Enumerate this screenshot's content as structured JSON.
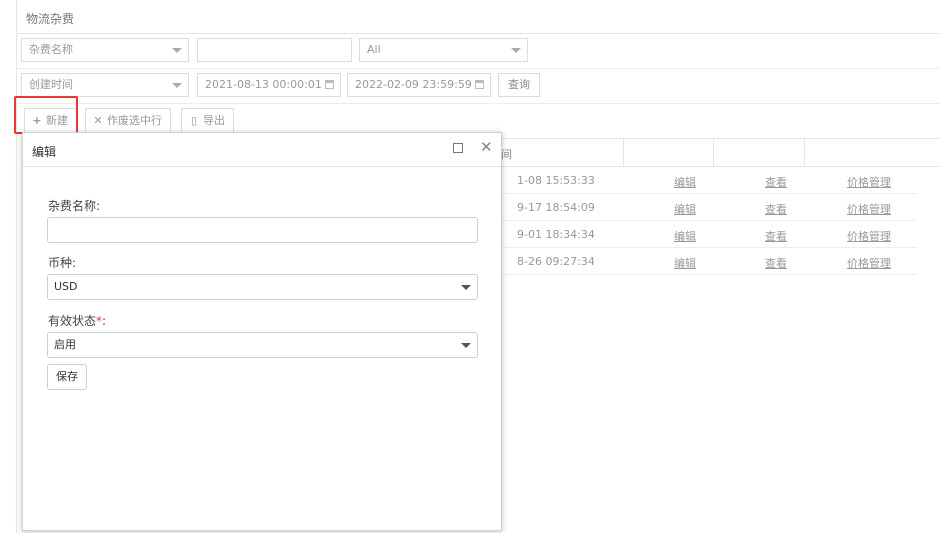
{
  "panel": {
    "title": "物流杂费"
  },
  "filters": {
    "name_type": "杂费名称",
    "name_value": "",
    "status_value": "All",
    "time_type": "创建时间",
    "start_time": "2021-08-13 00:00:01",
    "end_time": "2022-02-09 23:59:59",
    "query_label": "查询"
  },
  "toolbar": {
    "new_label": "新建",
    "void_label": "作废选中行",
    "export_label": "导出"
  },
  "table": {
    "header_partial": "间",
    "rows": [
      {
        "time": "1-08 15:53:33",
        "edit": "编辑",
        "view": "查看",
        "price": "价格管理"
      },
      {
        "time": "9-17 18:54:09",
        "edit": "编辑",
        "view": "查看",
        "price": "价格管理"
      },
      {
        "time": "9-01 18:34:34",
        "edit": "编辑",
        "view": "查看",
        "price": "价格管理"
      },
      {
        "time": "8-26 09:27:34",
        "edit": "编辑",
        "view": "查看",
        "price": "价格管理"
      }
    ]
  },
  "modal": {
    "title": "编辑",
    "name_label": "杂费名称:",
    "name_value": "",
    "currency_label": "币种:",
    "currency_value": "USD",
    "status_label": "有效状态",
    "status_required": "*",
    "status_colon": ":",
    "status_value": "启用",
    "save_label": "保存"
  },
  "colors": {
    "highlight": "#e53935",
    "required": "#e53935"
  }
}
